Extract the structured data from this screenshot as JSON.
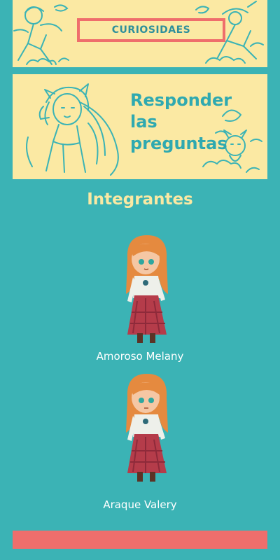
{
  "header": {
    "button_label": "CURIOSIDAES"
  },
  "hero": {
    "title_lines": [
      "Responder",
      "las",
      "preguntas"
    ]
  },
  "members_section": {
    "heading": "Integrantes",
    "members": [
      {
        "name": "Amoroso Melany",
        "avatar_icon": "girl-character-illustration"
      },
      {
        "name": "Araque Valery",
        "avatar_icon": "girl-character-illustration"
      }
    ]
  },
  "colors": {
    "background": "#3bb3b5",
    "banner": "#fbe9a3",
    "accent": "#ef6e6c",
    "title_text": "#2fa9b0"
  }
}
